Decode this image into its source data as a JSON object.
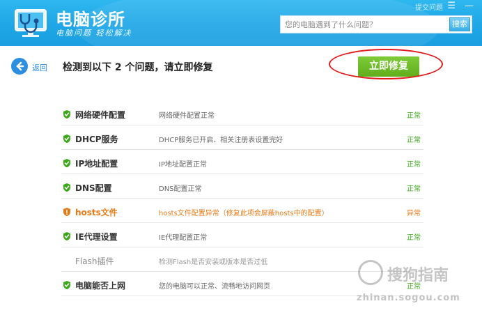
{
  "header": {
    "title": "电脑诊所",
    "subtitle": "电脑问题  轻松解决",
    "top_link": "提交问题",
    "search": {
      "placeholder": "您的电脑遇到了什么问题？",
      "button_label": "搜索"
    }
  },
  "toolbar": {
    "back_label": "返回",
    "headline": "检测到以下 2 个问题，请立即修复",
    "fix_label": "立即修复"
  },
  "rows": [
    {
      "name": "网络硬件配置",
      "desc": "网络硬件配置正常",
      "status": "正常",
      "state": "ok"
    },
    {
      "name": "DHCP服务",
      "desc": "DHCP服务已开启、相关注册表设置完好",
      "status": "正常",
      "state": "ok"
    },
    {
      "name": "IP地址配置",
      "desc": "IP地址配置正常",
      "status": "正常",
      "state": "ok"
    },
    {
      "name": "DNS配置",
      "desc": "DNS配置正常",
      "status": "正常",
      "state": "ok"
    },
    {
      "name": "hosts文件",
      "desc": "hosts文件配置异常（修复此项会屏蔽hosts中的配置）",
      "status": "异常",
      "state": "warn"
    },
    {
      "name": "IE代理设置",
      "desc": "IE代理配置正常",
      "status": "正常",
      "state": "ok"
    },
    {
      "name": "Flash插件",
      "desc": "检测Flash是否安装或版本是否过低",
      "status": "",
      "state": "pending"
    },
    {
      "name": "电脑能否上网",
      "desc": "您的电脑可以正常、流畅地访问网页",
      "status": "正常",
      "state": "ok"
    }
  ],
  "watermark": {
    "text": "搜狗指南",
    "url": "zhinan.sogou.com"
  },
  "colors": {
    "header": "#1ea6e6",
    "ok": "#3aa819",
    "warn": "#e87a15",
    "fix_button": "#5fae1c",
    "highlight": "#e21a1a"
  }
}
